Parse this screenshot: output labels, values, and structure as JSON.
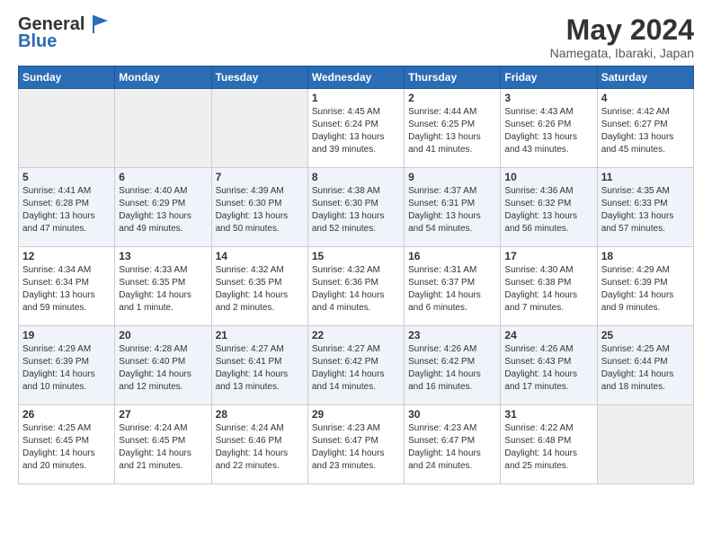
{
  "header": {
    "logo_general": "General",
    "logo_blue": "Blue",
    "title": "May 2024",
    "location": "Namegata, Ibaraki, Japan"
  },
  "weekdays": [
    "Sunday",
    "Monday",
    "Tuesday",
    "Wednesday",
    "Thursday",
    "Friday",
    "Saturday"
  ],
  "weeks": [
    [
      {
        "day": "",
        "info": "",
        "empty": true
      },
      {
        "day": "",
        "info": "",
        "empty": true
      },
      {
        "day": "",
        "info": "",
        "empty": true
      },
      {
        "day": "1",
        "info": "Sunrise: 4:45 AM\nSunset: 6:24 PM\nDaylight: 13 hours\nand 39 minutes.",
        "empty": false
      },
      {
        "day": "2",
        "info": "Sunrise: 4:44 AM\nSunset: 6:25 PM\nDaylight: 13 hours\nand 41 minutes.",
        "empty": false
      },
      {
        "day": "3",
        "info": "Sunrise: 4:43 AM\nSunset: 6:26 PM\nDaylight: 13 hours\nand 43 minutes.",
        "empty": false
      },
      {
        "day": "4",
        "info": "Sunrise: 4:42 AM\nSunset: 6:27 PM\nDaylight: 13 hours\nand 45 minutes.",
        "empty": false
      }
    ],
    [
      {
        "day": "5",
        "info": "Sunrise: 4:41 AM\nSunset: 6:28 PM\nDaylight: 13 hours\nand 47 minutes.",
        "empty": false
      },
      {
        "day": "6",
        "info": "Sunrise: 4:40 AM\nSunset: 6:29 PM\nDaylight: 13 hours\nand 49 minutes.",
        "empty": false
      },
      {
        "day": "7",
        "info": "Sunrise: 4:39 AM\nSunset: 6:30 PM\nDaylight: 13 hours\nand 50 minutes.",
        "empty": false
      },
      {
        "day": "8",
        "info": "Sunrise: 4:38 AM\nSunset: 6:30 PM\nDaylight: 13 hours\nand 52 minutes.",
        "empty": false
      },
      {
        "day": "9",
        "info": "Sunrise: 4:37 AM\nSunset: 6:31 PM\nDaylight: 13 hours\nand 54 minutes.",
        "empty": false
      },
      {
        "day": "10",
        "info": "Sunrise: 4:36 AM\nSunset: 6:32 PM\nDaylight: 13 hours\nand 56 minutes.",
        "empty": false
      },
      {
        "day": "11",
        "info": "Sunrise: 4:35 AM\nSunset: 6:33 PM\nDaylight: 13 hours\nand 57 minutes.",
        "empty": false
      }
    ],
    [
      {
        "day": "12",
        "info": "Sunrise: 4:34 AM\nSunset: 6:34 PM\nDaylight: 13 hours\nand 59 minutes.",
        "empty": false
      },
      {
        "day": "13",
        "info": "Sunrise: 4:33 AM\nSunset: 6:35 PM\nDaylight: 14 hours\nand 1 minute.",
        "empty": false
      },
      {
        "day": "14",
        "info": "Sunrise: 4:32 AM\nSunset: 6:35 PM\nDaylight: 14 hours\nand 2 minutes.",
        "empty": false
      },
      {
        "day": "15",
        "info": "Sunrise: 4:32 AM\nSunset: 6:36 PM\nDaylight: 14 hours\nand 4 minutes.",
        "empty": false
      },
      {
        "day": "16",
        "info": "Sunrise: 4:31 AM\nSunset: 6:37 PM\nDaylight: 14 hours\nand 6 minutes.",
        "empty": false
      },
      {
        "day": "17",
        "info": "Sunrise: 4:30 AM\nSunset: 6:38 PM\nDaylight: 14 hours\nand 7 minutes.",
        "empty": false
      },
      {
        "day": "18",
        "info": "Sunrise: 4:29 AM\nSunset: 6:39 PM\nDaylight: 14 hours\nand 9 minutes.",
        "empty": false
      }
    ],
    [
      {
        "day": "19",
        "info": "Sunrise: 4:29 AM\nSunset: 6:39 PM\nDaylight: 14 hours\nand 10 minutes.",
        "empty": false
      },
      {
        "day": "20",
        "info": "Sunrise: 4:28 AM\nSunset: 6:40 PM\nDaylight: 14 hours\nand 12 minutes.",
        "empty": false
      },
      {
        "day": "21",
        "info": "Sunrise: 4:27 AM\nSunset: 6:41 PM\nDaylight: 14 hours\nand 13 minutes.",
        "empty": false
      },
      {
        "day": "22",
        "info": "Sunrise: 4:27 AM\nSunset: 6:42 PM\nDaylight: 14 hours\nand 14 minutes.",
        "empty": false
      },
      {
        "day": "23",
        "info": "Sunrise: 4:26 AM\nSunset: 6:42 PM\nDaylight: 14 hours\nand 16 minutes.",
        "empty": false
      },
      {
        "day": "24",
        "info": "Sunrise: 4:26 AM\nSunset: 6:43 PM\nDaylight: 14 hours\nand 17 minutes.",
        "empty": false
      },
      {
        "day": "25",
        "info": "Sunrise: 4:25 AM\nSunset: 6:44 PM\nDaylight: 14 hours\nand 18 minutes.",
        "empty": false
      }
    ],
    [
      {
        "day": "26",
        "info": "Sunrise: 4:25 AM\nSunset: 6:45 PM\nDaylight: 14 hours\nand 20 minutes.",
        "empty": false
      },
      {
        "day": "27",
        "info": "Sunrise: 4:24 AM\nSunset: 6:45 PM\nDaylight: 14 hours\nand 21 minutes.",
        "empty": false
      },
      {
        "day": "28",
        "info": "Sunrise: 4:24 AM\nSunset: 6:46 PM\nDaylight: 14 hours\nand 22 minutes.",
        "empty": false
      },
      {
        "day": "29",
        "info": "Sunrise: 4:23 AM\nSunset: 6:47 PM\nDaylight: 14 hours\nand 23 minutes.",
        "empty": false
      },
      {
        "day": "30",
        "info": "Sunrise: 4:23 AM\nSunset: 6:47 PM\nDaylight: 14 hours\nand 24 minutes.",
        "empty": false
      },
      {
        "day": "31",
        "info": "Sunrise: 4:22 AM\nSunset: 6:48 PM\nDaylight: 14 hours\nand 25 minutes.",
        "empty": false
      },
      {
        "day": "",
        "info": "",
        "empty": true
      }
    ]
  ]
}
